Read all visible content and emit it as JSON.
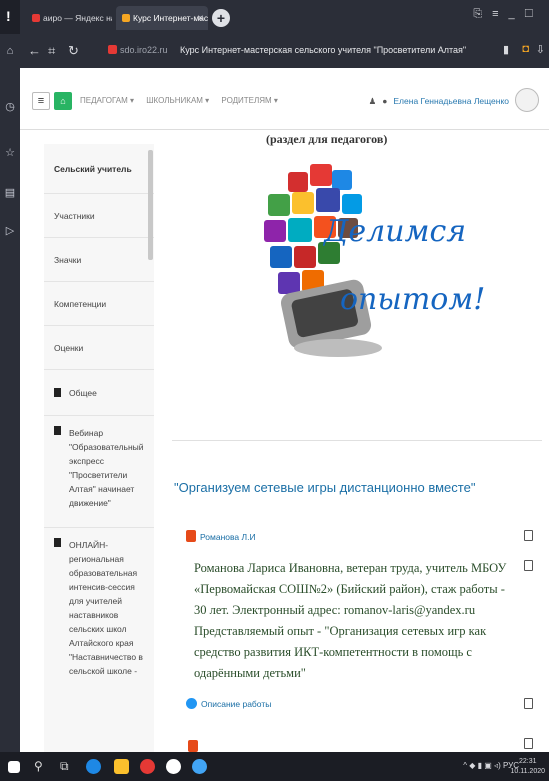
{
  "browser": {
    "tabs": [
      {
        "label": "аиро — Яндекс нашлось",
        "active": false
      },
      {
        "label": "Курс Интернет-масте",
        "active": true
      }
    ],
    "tab_close": "✕",
    "new_tab": "+",
    "url": "sdo.iro22.ru",
    "page_title": "Курс Интернет-мастерская сельского учителя \"Просветители Алтая\""
  },
  "site_nav": {
    "menu": [
      "ПЕДАГОГАМ ▾",
      "ШКОЛЬНИКАМ ▾",
      "РОДИТЕЛЯМ ▾"
    ],
    "user_name": "Елена Геннадьевна Лещенко"
  },
  "course_nav": {
    "items": [
      {
        "label": "Сельский учитель",
        "bold": true,
        "folder": false
      },
      {
        "label": "Участники",
        "bold": false,
        "folder": false
      },
      {
        "label": "Значки",
        "bold": false,
        "folder": false
      },
      {
        "label": "Компетенции",
        "bold": false,
        "folder": false
      },
      {
        "label": "Оценки",
        "bold": false,
        "folder": false
      },
      {
        "label": "Общее",
        "bold": false,
        "folder": true
      },
      {
        "label": "Вебинар \"Образовательный экспресс \"Просветители Алтая\" начинает движение\"",
        "bold": false,
        "folder": true
      },
      {
        "label": "ОНЛАЙН-региональная образовательная интенсив-сессия для учителей наставников сельских школ Алтайского края \"Наставничество в сельской школе -",
        "bold": false,
        "folder": true
      }
    ]
  },
  "content": {
    "section_title": "(раздел для педагогов)",
    "hero_line1": "Делимся",
    "hero_line2": "опытом!",
    "topic_title": "\"Организуем сетевые игры дистанционно вместе\"",
    "author": "Романова Л.И",
    "description": "Романова Лариса Ивановна, ветеран труда, учитель МБОУ «Первомайская СОШ№2» (Бийский район), стаж работы - 30 лет. Электронный адрес: romanov-laris@yandex.ru Представляемый опыт - \"Организация сетевых игр как средство развития ИКТ-компетентности в помощь с одарёнными детьми\"",
    "work_link": "Описание работы"
  },
  "taskbar": {
    "lang": "РУС",
    "time": "22:31",
    "date": "10.11.2020"
  }
}
